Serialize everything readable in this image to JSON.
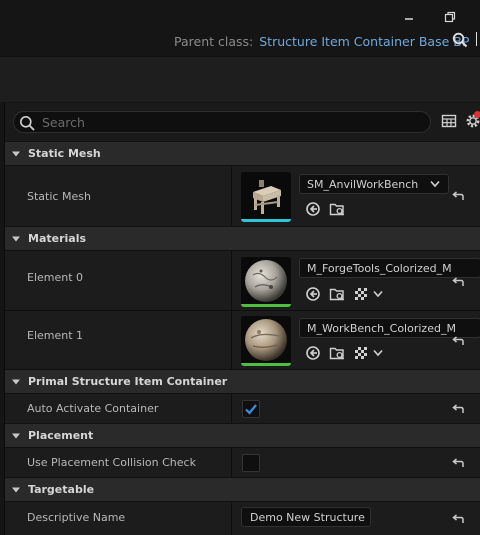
{
  "header": {
    "parent_class_label": "Parent class:",
    "parent_class_value": "Structure Item Container Base BP"
  },
  "details": {
    "search_placeholder": "Search",
    "sections": {
      "static_mesh": {
        "title": "Static Mesh",
        "row_label": "Static Mesh",
        "asset": "SM_AnvilWorkBench",
        "thumb_bar_color": "#2fc4d8"
      },
      "materials": {
        "title": "Materials",
        "element0_label": "Element 0",
        "element0_asset": "M_ForgeTools_Colorized_M",
        "element1_label": "Element 1",
        "element1_asset": "M_WorkBench_Colorized_M",
        "thumb_bar_color": "#4ec040"
      },
      "primal": {
        "title": "Primal Structure Item Container",
        "auto_activate_label": "Auto Activate Container",
        "auto_activate_checked": true
      },
      "placement": {
        "title": "Placement",
        "collision_label": "Use Placement Collision Check",
        "collision_checked": false
      },
      "targetable": {
        "title": "Targetable",
        "descriptive_label": "Descriptive Name",
        "descriptive_value": "Demo New Structure"
      }
    }
  },
  "colors": {
    "accent_link": "#6fa8dc",
    "checkbox_check": "#3a8fe0"
  }
}
